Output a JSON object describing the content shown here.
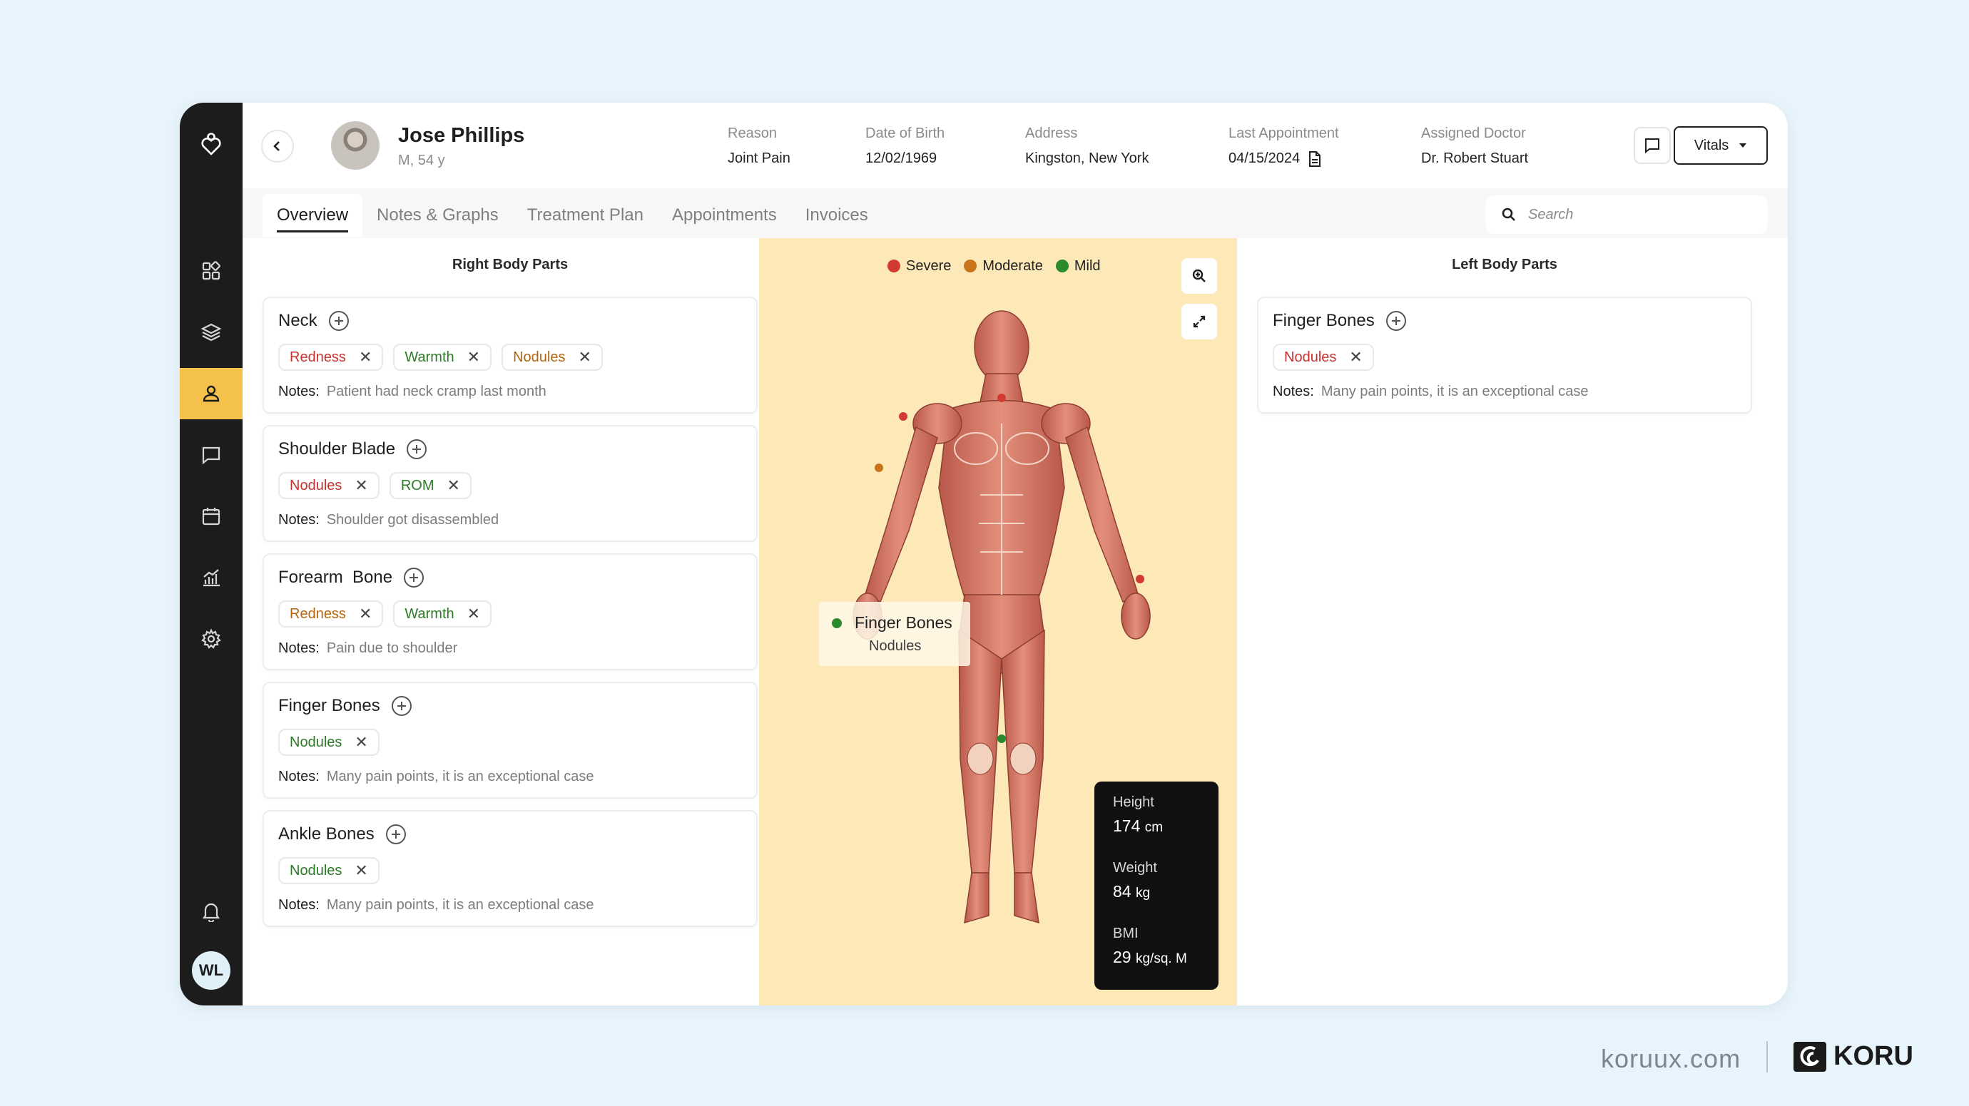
{
  "patient": {
    "name": "Jose Phillips",
    "sub": "M, 54 y",
    "reason_label": "Reason",
    "reason": "Joint Pain",
    "dob_label": "Date of Birth",
    "dob": "12/02/1969",
    "address_label": "Address",
    "address": "Kingston, New York",
    "last_appt_label": "Last Appointment",
    "last_appt": "04/15/2024",
    "doctor_label": "Assigned Doctor",
    "doctor": "Dr. Robert Stuart"
  },
  "header": {
    "vitals_label": "Vitals"
  },
  "tabs": [
    "Overview",
    "Notes & Graphs",
    "Treatment Plan",
    "Appointments",
    "Invoices"
  ],
  "search": {
    "placeholder": "Search"
  },
  "right_panel": {
    "title": "Right Body Parts",
    "notes_label": "Notes:",
    "cards": [
      {
        "title": "Neck",
        "chips": [
          {
            "label": "Redness",
            "severity": "severe"
          },
          {
            "label": "Warmth",
            "severity": "mild"
          },
          {
            "label": "Nodules",
            "severity": "moderate"
          }
        ],
        "notes": "Patient had neck cramp last month"
      },
      {
        "title": "Shoulder Blade",
        "chips": [
          {
            "label": "Nodules",
            "severity": "severe"
          },
          {
            "label": "ROM",
            "severity": "mild"
          }
        ],
        "notes": "Shoulder got disassembled"
      },
      {
        "title": "Forearm  Bone",
        "chips": [
          {
            "label": "Redness",
            "severity": "moderate"
          },
          {
            "label": "Warmth",
            "severity": "mild"
          }
        ],
        "notes": "Pain due to shoulder"
      },
      {
        "title": "Finger Bones",
        "chips": [
          {
            "label": "Nodules",
            "severity": "mild"
          }
        ],
        "notes": "Many pain points, it is an exceptional case"
      },
      {
        "title": "Ankle Bones",
        "chips": [
          {
            "label": "Nodules",
            "severity": "mild"
          }
        ],
        "notes": "Many pain points, it is an exceptional case"
      }
    ]
  },
  "left_panel": {
    "title": "Left Body Parts",
    "notes_label": "Notes:",
    "cards": [
      {
        "title": "Finger Bones",
        "chips": [
          {
            "label": "Nodules",
            "severity": "severe"
          }
        ],
        "notes": "Many pain points, it is an exceptional case"
      }
    ]
  },
  "legend": {
    "severe": "Severe",
    "moderate": "Moderate",
    "mild": "Mild",
    "colors": {
      "severe": "#d23a31",
      "moderate": "#c7741a",
      "mild": "#2a8a2c"
    }
  },
  "tooltip": {
    "title": "Finger Bones",
    "sub": "Nodules"
  },
  "vitals": {
    "height_label": "Height",
    "height": "174",
    "height_unit": "cm",
    "weight_label": "Weight",
    "weight": "84",
    "weight_unit": "kg",
    "bmi_label": "BMI",
    "bmi": "29",
    "bmi_unit": "kg/sq. M"
  },
  "user": {
    "initials": "WL"
  },
  "footer": {
    "site": "koruux.com",
    "brand": "KORU"
  },
  "colors": {
    "sidebar": "#1c1c1c",
    "active": "#f4c24b",
    "body_panel": "#fde8b8"
  },
  "icons": [
    "heart-logo-icon",
    "dashboard-icon",
    "layers-icon",
    "user-icon",
    "chat-icon",
    "calendar-icon",
    "analytics-icon",
    "settings-icon",
    "bell-icon",
    "search-icon",
    "zoom-in-icon",
    "expand-icon",
    "phone-icon",
    "message-icon",
    "document-icon",
    "chevron-left-icon",
    "chevron-down-icon"
  ]
}
